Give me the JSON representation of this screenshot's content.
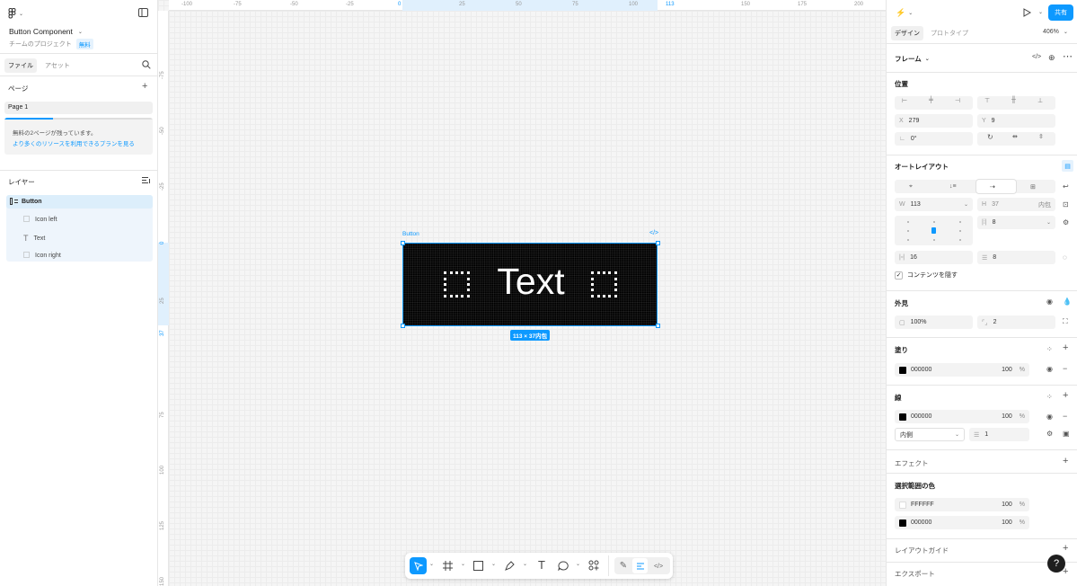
{
  "file": {
    "title": "Button Component",
    "project": "チームのプロジェクト",
    "plan_badge": "無料"
  },
  "left_tabs": {
    "file": "ファイル",
    "assets": "アセット"
  },
  "pages": {
    "heading": "ページ",
    "current": "Page 1",
    "notice_line1": "無料の2ページが残っています。",
    "notice_line2": "より多くのリソースを利用できるプランを見る",
    "progress": 0.33
  },
  "layers": {
    "heading": "レイヤー",
    "items": [
      {
        "name": "Button",
        "icon": "auto-layout-icon"
      },
      {
        "name": "Icon left",
        "icon": "frame-icon"
      },
      {
        "name": "Text",
        "icon": "text-icon"
      },
      {
        "name": "Icon right",
        "icon": "frame-icon"
      }
    ]
  },
  "ruler_h": [
    "-100",
    "-75",
    "-50",
    "-25",
    "0",
    "25",
    "50",
    "75",
    "100",
    "113",
    "150",
    "175",
    "200"
  ],
  "ruler_v": [
    "-75",
    "-50",
    "-25",
    "0",
    "25",
    "37",
    "75",
    "100",
    "125",
    "150"
  ],
  "canvas": {
    "frame_label": "Button",
    "button_text": "Text",
    "size_badge": "113 × 37内包"
  },
  "right": {
    "tabs": {
      "design": "デザイン",
      "prototype": "プロトタイプ"
    },
    "zoom": "406%",
    "share": "共有",
    "frame_title": "フレーム",
    "position": {
      "heading": "位置",
      "x_label": "X",
      "x": "279",
      "y_label": "Y",
      "y": "9",
      "rot": "0°"
    },
    "autolayout": {
      "heading": "オートレイアウト",
      "w_label": "W",
      "w": "113",
      "h_label": "H",
      "h": "37",
      "h_mode": "内包",
      "gap": "8",
      "pad_h": "16",
      "pad_v": "8",
      "clip": "コンテンツを隠す"
    },
    "appearance": {
      "heading": "外見",
      "opacity": "100%",
      "radius": "2"
    },
    "fill": {
      "heading": "塗り",
      "hex": "000000",
      "opacity": "100",
      "pct": "%"
    },
    "stroke": {
      "heading": "線",
      "hex": "000000",
      "opacity": "100",
      "pct": "%",
      "position": "内側",
      "weight": "1"
    },
    "effects": {
      "heading": "エフェクト"
    },
    "selection_colors": {
      "heading": "選択範囲の色",
      "c1": "FFFFFF",
      "c1_opacity": "100",
      "c2": "000000",
      "c2_opacity": "100",
      "pct": "%"
    },
    "layout_guide": {
      "heading": "レイアウトガイド"
    },
    "export": {
      "heading": "エクスポート"
    },
    "help": "?"
  },
  "colors": {
    "accent": "#0d99ff",
    "selection_bg": "#e8f3fd",
    "button_bg": "#000000"
  }
}
